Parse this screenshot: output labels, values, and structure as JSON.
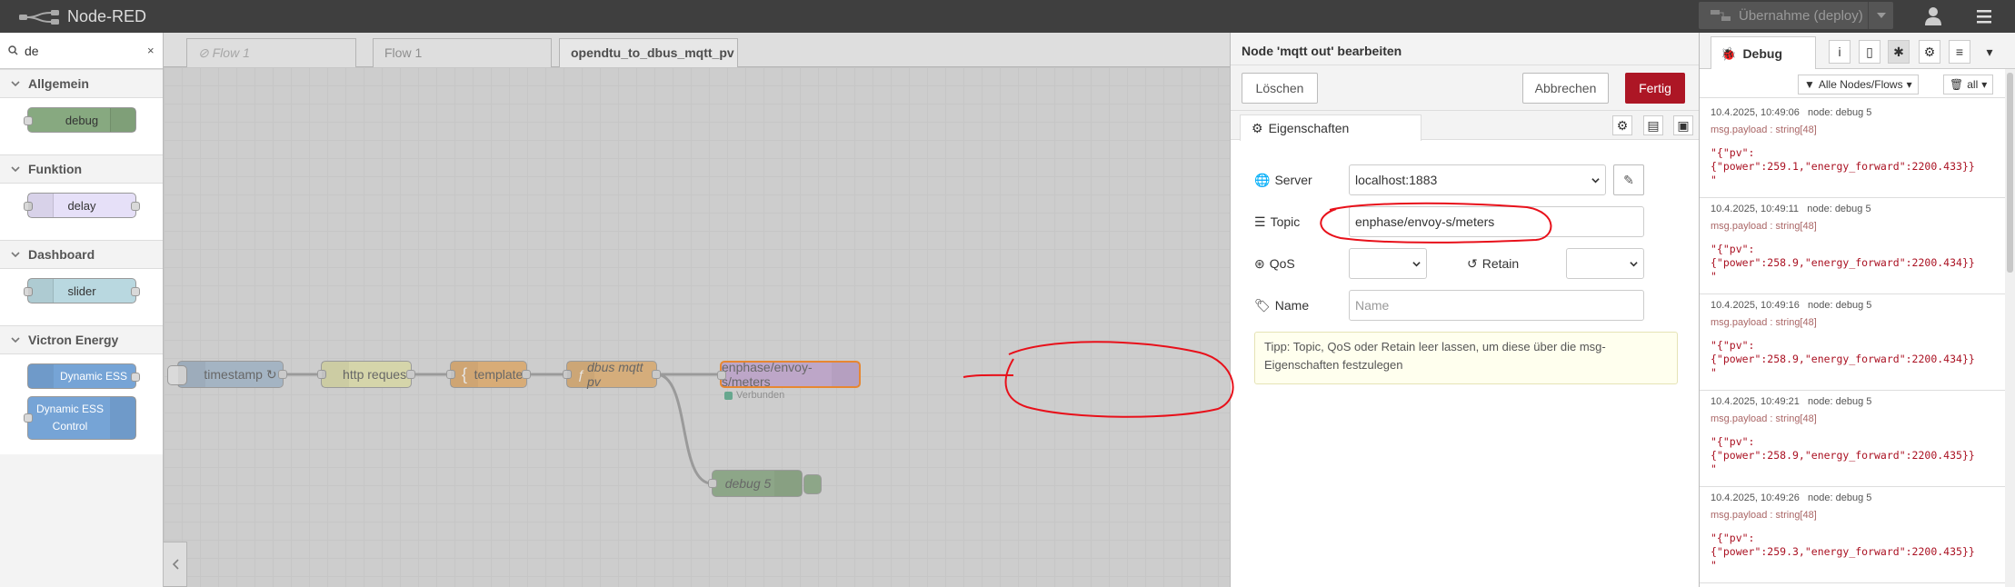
{
  "header": {
    "title": "Node-RED",
    "deploy_label": "Übernahme (deploy)"
  },
  "palette": {
    "search_value": "de",
    "clear": "×",
    "categories": [
      {
        "name": "Allgemein",
        "nodes": [
          "debug"
        ]
      },
      {
        "name": "Funktion",
        "nodes": [
          "delay"
        ]
      },
      {
        "name": "Dashboard",
        "nodes": [
          "slider"
        ]
      },
      {
        "name": "Victron Energy",
        "nodes": [
          "Dynamic ESS",
          "Dynamic ESS Control"
        ]
      }
    ]
  },
  "workspace": {
    "tabs": [
      "Flow 1",
      "Flow 1",
      "opendtu_to_dbus_mqtt_pv"
    ],
    "nodes": {
      "timestamp": "timestamp ↻",
      "http": "http request",
      "template": "template",
      "dbus": "dbus mqtt pv",
      "mqtt": "enphase/envoy-s/meters",
      "mqtt_status": "Verbunden",
      "debug": "debug 5"
    }
  },
  "editor": {
    "title": "Node 'mqtt out' bearbeiten",
    "delete_label": "Löschen",
    "cancel_label": "Abbrechen",
    "done_label": "Fertig",
    "tab_label": "Eigenschaften",
    "server_label": "Server",
    "server_value": "localhost:1883",
    "topic_label": "Topic",
    "topic_value": "enphase/envoy-s/meters",
    "qos_label": "QoS",
    "retain_label": "Retain",
    "name_label": "Name",
    "name_placeholder": "Name",
    "tip": "Tipp: Topic, QoS oder Retain leer lassen, um diese über die msg-Eigenschaften festzulegen"
  },
  "sidebar": {
    "tab_label": "Debug",
    "filter_label": "Alle Nodes/Flows",
    "clear_label": "all",
    "messages": [
      {
        "time": "10.4.2025, 10:49:06",
        "node": "node: debug 5",
        "topic": "msg.payload : string[48]",
        "payload": "\"{\"pv\":\n{\"power\":259.1,\"energy_forward\":2200.433}}\n\""
      },
      {
        "time": "10.4.2025, 10:49:11",
        "node": "node: debug 5",
        "topic": "msg.payload : string[48]",
        "payload": "\"{\"pv\":\n{\"power\":258.9,\"energy_forward\":2200.434}}\n\""
      },
      {
        "time": "10.4.2025, 10:49:16",
        "node": "node: debug 5",
        "topic": "msg.payload : string[48]",
        "payload": "\"{\"pv\":\n{\"power\":258.9,\"energy_forward\":2200.434}}\n\""
      },
      {
        "time": "10.4.2025, 10:49:21",
        "node": "node: debug 5",
        "topic": "msg.payload : string[48]",
        "payload": "\"{\"pv\":\n{\"power\":258.9,\"energy_forward\":2200.435}}\n\""
      },
      {
        "time": "10.4.2025, 10:49:26",
        "node": "node: debug 5",
        "topic": "msg.payload : string[48]",
        "payload": "\"{\"pv\":\n{\"power\":259.3,\"energy_forward\":2200.435}}\n\""
      }
    ]
  },
  "colors": {
    "header": "#3f3f3f",
    "primary": "#ad1625",
    "annotation": "#e8101a"
  }
}
